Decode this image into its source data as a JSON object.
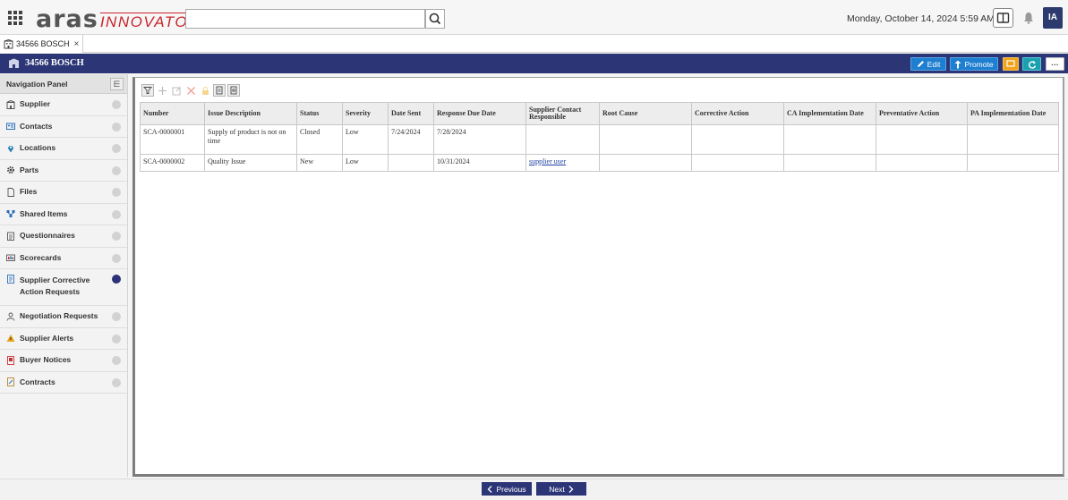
{
  "header": {
    "logo_main": "aras",
    "logo_sub": "INNOVATOR",
    "search_placeholder": "",
    "datetime": "Monday, October 14, 2024 5:59 AM",
    "user_initials": "IA"
  },
  "tab": {
    "label": "34566 BOSCH",
    "close": "×"
  },
  "titlebar": {
    "title": "34566 BOSCH",
    "edit_label": "Edit",
    "promote_label": "Promote",
    "more_label": "···"
  },
  "nav": {
    "title": "Navigation Panel",
    "items": [
      {
        "label": "Supplier",
        "icon": "building-icon"
      },
      {
        "label": "Contacts",
        "icon": "contact-card-icon"
      },
      {
        "label": "Locations",
        "icon": "map-pin-icon"
      },
      {
        "label": "Parts",
        "icon": "gear-icon"
      },
      {
        "label": "Files",
        "icon": "file-icon"
      },
      {
        "label": "Shared Items",
        "icon": "shared-items-icon"
      },
      {
        "label": "Questionnaires",
        "icon": "clipboard-icon"
      },
      {
        "label": "Scorecards",
        "icon": "scorecard-icon"
      },
      {
        "label": "Supplier Corrective",
        "label2": "Action Requests",
        "icon": "request-icon"
      },
      {
        "label": "Negotiation Requests",
        "icon": "negotiation-icon"
      },
      {
        "label": "Supplier Alerts",
        "icon": "alert-icon"
      },
      {
        "label": "Buyer Notices",
        "icon": "notice-icon"
      },
      {
        "label": "Contracts",
        "icon": "contract-icon"
      }
    ]
  },
  "table": {
    "columns": [
      "Number",
      "Issue Description",
      "Status",
      "Severity",
      "Date Sent",
      "Response Due Date",
      "Supplier Contact Responsible",
      "Root Cause",
      "Corrective Action",
      "CA Implementation Date",
      "Preventative Action",
      "PA Implementation Date"
    ],
    "rows": [
      {
        "number": "SCA-0000001",
        "issue": "Supply of product is not on time",
        "status": "Closed",
        "severity": "Low",
        "date_sent": "7/24/2024",
        "due": "7/28/2024",
        "contact": "",
        "root_cause": "",
        "corrective": "",
        "ca_date": "",
        "preventative": "",
        "pa_date": ""
      },
      {
        "number": "SCA-0000002",
        "issue": "Quality Issue",
        "status": "New",
        "severity": "Low",
        "date_sent": "",
        "due": "10/31/2024",
        "contact": "supplier user",
        "root_cause": "",
        "corrective": "",
        "ca_date": "",
        "preventative": "",
        "pa_date": ""
      }
    ]
  },
  "pager": {
    "previous": "Previous",
    "next": "Next"
  },
  "colors": {
    "brand_navy": "#2c3576",
    "accent_blue": "#1e7ed0",
    "logo_red": "#c8252c",
    "orange": "#f0a31a",
    "teal": "#1ba0b0"
  }
}
